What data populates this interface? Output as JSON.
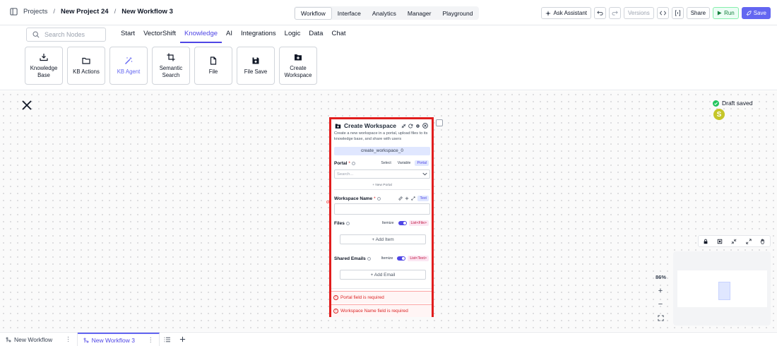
{
  "breadcrumb": {
    "root": "Projects",
    "project": "New Project 24",
    "workflow": "New Workflow 3"
  },
  "view_tabs": [
    {
      "label": "Workflow",
      "active": true
    },
    {
      "label": "Interface",
      "active": false
    },
    {
      "label": "Analytics",
      "active": false
    },
    {
      "label": "Manager",
      "active": false
    },
    {
      "label": "Playground",
      "active": false
    }
  ],
  "header_actions": {
    "ask_assistant": "Ask Assistant",
    "versions": "Versions",
    "share": "Share",
    "run": "Run",
    "save": "Save"
  },
  "search": {
    "placeholder": "Search Nodes"
  },
  "categories": [
    {
      "label": "Start",
      "active": false
    },
    {
      "label": "VectorShift",
      "active": false
    },
    {
      "label": "Knowledge",
      "active": true
    },
    {
      "label": "AI",
      "active": false
    },
    {
      "label": "Integrations",
      "active": false
    },
    {
      "label": "Logic",
      "active": false
    },
    {
      "label": "Data",
      "active": false
    },
    {
      "label": "Chat",
      "active": false
    }
  ],
  "node_tiles": [
    {
      "label": "Knowledge Base",
      "icon": "download-icon",
      "active": false
    },
    {
      "label": "KB Actions",
      "icon": "folder-icon",
      "active": false
    },
    {
      "label": "KB Agent",
      "icon": "magic-wand-icon",
      "active": true
    },
    {
      "label": "Semantic Search",
      "icon": "crop-icon",
      "active": false
    },
    {
      "label": "File",
      "icon": "file-icon",
      "active": false
    },
    {
      "label": "File Save",
      "icon": "floppy-icon",
      "active": false
    },
    {
      "label": "Create Workspace",
      "icon": "folder-plus-icon",
      "active": false
    }
  ],
  "status": {
    "draft": "Draft saved",
    "avatar_initial": "S"
  },
  "node": {
    "title": "Create Workspace",
    "description": "Create a new workspace in a portal, upload files to its knowledge base, and share with users",
    "id": "create_workspace_0",
    "portal": {
      "label": "Portal",
      "required": "*",
      "modes": [
        "Select",
        "Variable"
      ],
      "type": "Portal",
      "placeholder": "Search...",
      "new_portal": "+ New Portal"
    },
    "workspace_name": {
      "label": "Workspace Name",
      "required": "*",
      "type": "Text"
    },
    "files": {
      "label": "Files",
      "toggle_label": "Itemize",
      "type": "List<File>",
      "add": "+ Add Item"
    },
    "shared_emails": {
      "label": "Shared Emails",
      "toggle_label": "Itemize",
      "type": "List<Text>",
      "add": "+ Add Email"
    },
    "errors": [
      "Portal field is required",
      "Workspace Name field is required"
    ]
  },
  "zoom": {
    "level": "86%",
    "plus": "+",
    "minus": "−"
  },
  "bottom_tabs": [
    {
      "label": "New Workflow",
      "active": false
    },
    {
      "label": "New Workflow 3",
      "active": true
    }
  ],
  "colors": {
    "accent": "#6366f1",
    "error": "#e11d1d",
    "run": "#15803d",
    "avatar": "#c5c629"
  }
}
